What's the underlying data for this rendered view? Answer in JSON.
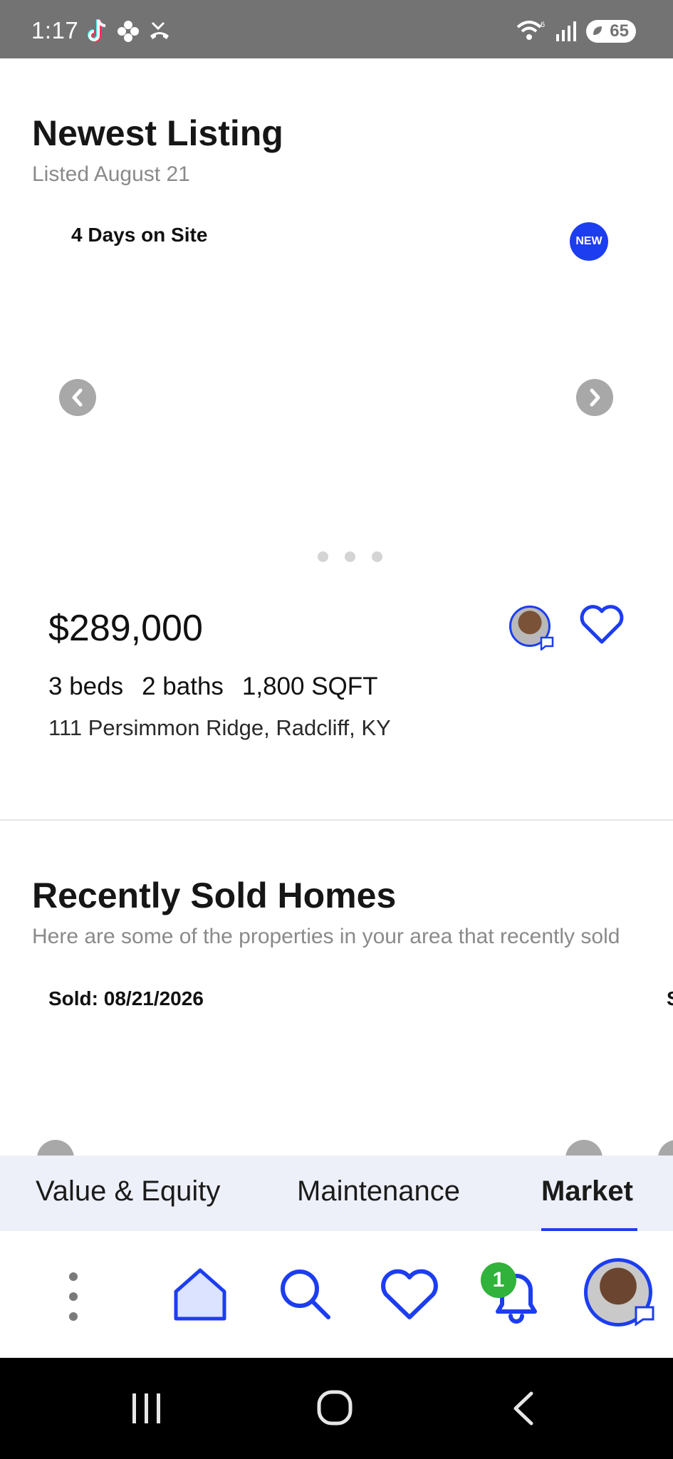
{
  "status_bar": {
    "time": "1:17",
    "battery": "65",
    "left_icons": [
      "tiktok-icon",
      "pinwheel-icon",
      "missed-call-icon"
    ],
    "right_icons": [
      "wifi-icon",
      "signal-icon",
      "battery-icon"
    ]
  },
  "newest_listing": {
    "title": "Newest Listing",
    "subtitle": "Listed August 21",
    "days_on_site": "4 Days on Site",
    "badge": "NEW",
    "price": "$289,000",
    "beds": "3 beds",
    "baths": "2 baths",
    "sqft": "1,800 SQFT",
    "address": "111 Persimmon Ridge, Radcliff, KY",
    "carousel_pages": 3
  },
  "recently_sold": {
    "title": "Recently Sold Homes",
    "subtitle": "Here are some of the properties in your area that recently sold",
    "cards": [
      {
        "sold_label": "Sold: 08/21/2026"
      },
      {
        "sold_label": "S"
      }
    ]
  },
  "tabs": [
    {
      "label": "Value & Equity",
      "active": false
    },
    {
      "label": "Maintenance",
      "active": false
    },
    {
      "label": "Market",
      "active": true
    }
  ],
  "bottom_nav": {
    "items": [
      "more-icon",
      "home-icon",
      "search-icon",
      "favorites-icon",
      "notifications-icon",
      "profile-avatar"
    ],
    "notification_count": "1"
  },
  "colors": {
    "accent": "#1c3df0",
    "badge_green": "#31b23a",
    "status_bar": "#737373",
    "tab_bg": "#eef0f9"
  }
}
